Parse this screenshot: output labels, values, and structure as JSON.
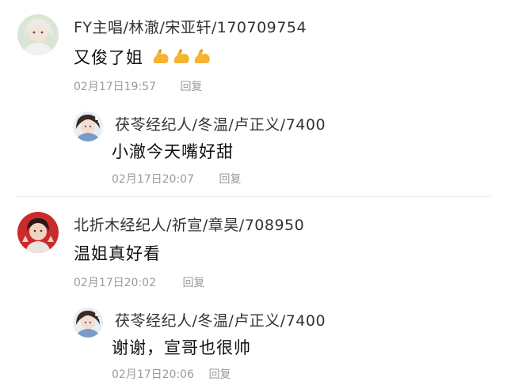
{
  "comments": [
    {
      "username": "FY主唱/林澈/宋亚轩/170709754",
      "text": "又俊了姐",
      "emoji": "flexed-biceps",
      "emoji_count": 3,
      "time": "02月17日19:57",
      "reply_label": "回复",
      "reply": {
        "username": "茯苓经纪人/冬温/卢正义/7400",
        "text": "小澈今天嘴好甜",
        "time": "02月17日20:07",
        "reply_label": "回复"
      }
    },
    {
      "username": "北折木经纪人/祈宣/章昊/708950",
      "text": "温姐真好看",
      "time": "02月17日20:02",
      "reply_label": "回复",
      "reply": {
        "username": "茯苓经纪人/冬温/卢正义/7400",
        "text": "谢谢，宣哥也很帅",
        "time": "02月17日20:06",
        "reply_label": "回复"
      }
    }
  ]
}
